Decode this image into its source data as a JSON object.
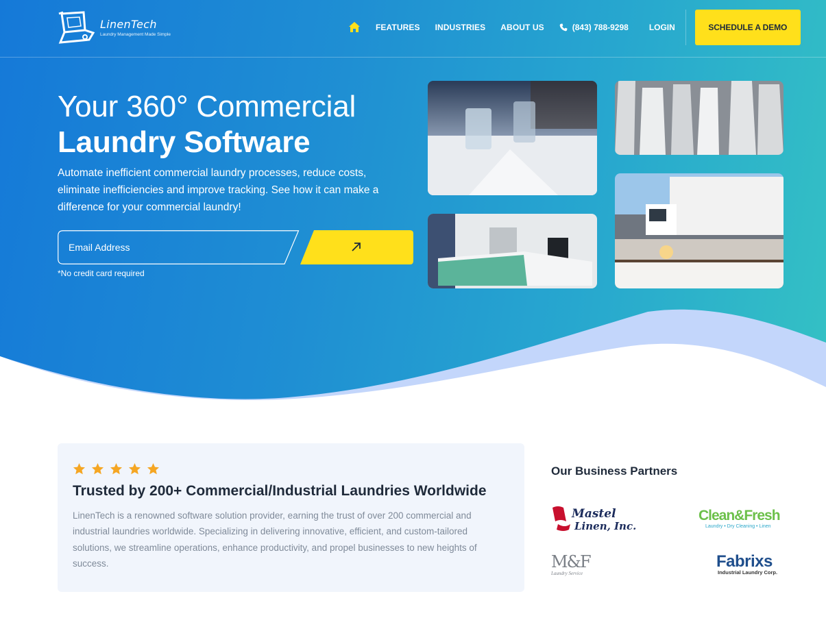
{
  "brand": {
    "name": "LinenTech",
    "tagline": "Laundry Management Made Simple"
  },
  "nav": {
    "home_icon": "home-icon",
    "items": [
      "FEATURES",
      "INDUSTRIES",
      "ABOUT US"
    ],
    "phone": "(843) 788-9298",
    "login": "LOGIN",
    "cta": "SCHEDULE A DEMO"
  },
  "hero": {
    "title_line1": "Your 360° Commercial",
    "title_line2": "Laundry Software",
    "description": "Automate inefficient commercial laundry processes, reduce costs, eliminate inefficiencies and improve tracking. See how it can make a difference for your commercial laundry!",
    "email_placeholder": "Email Address",
    "submit_icon": "arrow-up-right-icon",
    "note": "*No credit card required"
  },
  "trust": {
    "rating_stars": 5,
    "title": "Trusted by 200+ Commercial/Industrial Laundries Worldwide",
    "body": "LinenTech is a renowned software solution provider, earning the trust of over 200 commercial and industrial laundries worldwide. Specializing in delivering innovative, efficient, and custom-tailored solutions, we streamline operations, enhance productivity, and propel businesses to new heights of success."
  },
  "partners": {
    "title": "Our Business Partners",
    "logos": [
      {
        "name": "Mastel Linen, Inc.",
        "line1": "Mastel",
        "line2": "Linen, Inc."
      },
      {
        "name": "Clean & Fresh",
        "line1": "Clean&Fresh",
        "line2": "Laundry • Dry Cleaning • Linen"
      },
      {
        "name": "M&F Laundry Service",
        "line1": "M&F",
        "line2": "Laundry Service"
      },
      {
        "name": "Fabrixs Industrial Laundry Corp.",
        "line1": "Fabrixs",
        "line2": "Industrial Laundry Corp."
      }
    ]
  },
  "colors": {
    "gradient_start": "#1579d8",
    "gradient_end": "#34c1c4",
    "accent_yellow": "#ffe01b",
    "star": "#f5a623",
    "card_bg": "#f1f5fc"
  }
}
